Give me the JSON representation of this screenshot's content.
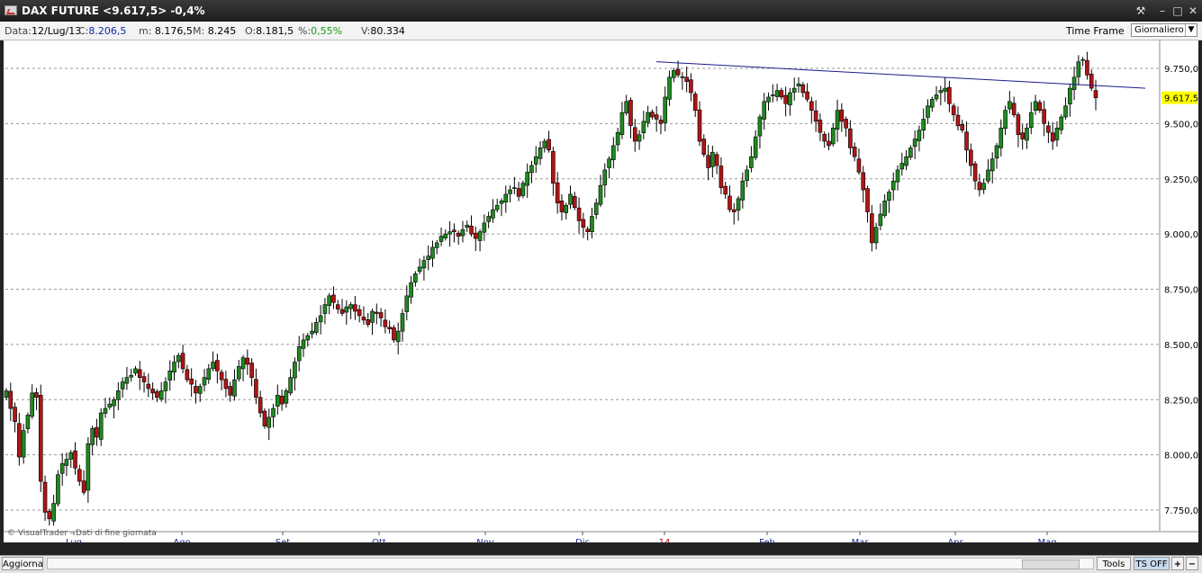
{
  "window": {
    "title": "DAX FUTURE <9.617,5> -0,4%"
  },
  "info": {
    "date_label": "Data:",
    "date_value": "12/Lug/13",
    "close_label": "C:",
    "close_value": "8.206,5",
    "low_label": "m:",
    "low_value": "8.176,5",
    "high_label": "M:",
    "high_value": "8.245",
    "open_label": "O:",
    "open_value": "8.181,5",
    "pct_label": "%:",
    "pct_value": "0,55%",
    "vol_label": "V:",
    "vol_value": "80.334",
    "timeframe_label": "Time Frame",
    "timeframe_value": "Giornaliero"
  },
  "bottom": {
    "update_label": "Aggiorna",
    "tools_label": "Tools",
    "ts_label": "TS OFF",
    "plus": "+",
    "minus": "−"
  },
  "watermark": "© VisualTrader - Dati di fine giornata",
  "colors": {
    "up": "#1f8a1f",
    "down": "#b01515",
    "trendline": "#1a1a8a",
    "last_price_bg": "#ffff00"
  },
  "chart_data": {
    "type": "candlestick",
    "y_ticks": [
      "9.750,0",
      "9.500,0",
      "9.250,0",
      "9.000,0",
      "8.750,0",
      "8.500,0",
      "8.250,0",
      "8.000,0",
      "7.750,0"
    ],
    "x_labels": [
      "Lug",
      "Ago",
      "Set",
      "Ott",
      "Nov",
      "Dic",
      "14",
      "Feb",
      "Mar",
      "Apr",
      "Mag"
    ],
    "last_price_label": "9.617,5",
    "trendline": {
      "from_value": 9780,
      "to_value": 9660
    },
    "ylim": [
      7680,
      9840
    ],
    "closes": [
      8290,
      8210,
      8150,
      7990,
      8110,
      8180,
      8280,
      8260,
      7880,
      7740,
      7710,
      7780,
      7910,
      7960,
      7980,
      8010,
      7940,
      7880,
      7830,
      8050,
      8120,
      8080,
      8190,
      8210,
      8230,
      8250,
      8290,
      8330,
      8350,
      8360,
      8390,
      8350,
      8330,
      8300,
      8280,
      8260,
      8290,
      8330,
      8380,
      8420,
      8450,
      8390,
      8340,
      8320,
      8280,
      8310,
      8350,
      8390,
      8420,
      8380,
      8340,
      8300,
      8270,
      8340,
      8400,
      8440,
      8410,
      8350,
      8260,
      8190,
      8130,
      8170,
      8210,
      8270,
      8230,
      8290,
      8350,
      8420,
      8490,
      8520,
      8540,
      8560,
      8600,
      8630,
      8680,
      8720,
      8690,
      8660,
      8640,
      8670,
      8680,
      8650,
      8630,
      8610,
      8590,
      8650,
      8640,
      8620,
      8580,
      8570,
      8520,
      8560,
      8640,
      8720,
      8780,
      8820,
      8850,
      8880,
      8900,
      8940,
      8960,
      8990,
      9000,
      9010,
      9010,
      8990,
      9020,
      9040,
      9000,
      8980,
      9010,
      9050,
      9080,
      9110,
      9130,
      9150,
      9180,
      9200,
      9210,
      9170,
      9230,
      9280,
      9310,
      9350,
      9390,
      9420,
      9380,
      9230,
      9140,
      9100,
      9130,
      9180,
      9120,
      9060,
      9030,
      9010,
      9080,
      9140,
      9220,
      9290,
      9340,
      9400,
      9460,
      9550,
      9600,
      9490,
      9420,
      9450,
      9510,
      9550,
      9530,
      9520,
      9500,
      9620,
      9710,
      9740,
      9720,
      9710,
      9690,
      9640,
      9560,
      9420,
      9360,
      9300,
      9370,
      9310,
      9210,
      9180,
      9110,
      9100,
      9160,
      9240,
      9290,
      9350,
      9440,
      9530,
      9600,
      9620,
      9630,
      9650,
      9620,
      9590,
      9640,
      9660,
      9680,
      9640,
      9610,
      9560,
      9510,
      9460,
      9420,
      9400,
      9480,
      9560,
      9510,
      9480,
      9390,
      9350,
      9280,
      9200,
      9100,
      8960,
      9030,
      9090,
      9150,
      9190,
      9240,
      9290,
      9320,
      9350,
      9390,
      9430,
      9470,
      9520,
      9580,
      9610,
      9630,
      9650,
      9660,
      9590,
      9540,
      9490,
      9470,
      9380,
      9310,
      9240,
      9200,
      9230,
      9290,
      9340,
      9400,
      9480,
      9560,
      9600,
      9540,
      9450,
      9430,
      9480,
      9550,
      9600,
      9560,
      9500,
      9460,
      9420,
      9480,
      9530,
      9580,
      9660,
      9710,
      9780,
      9790,
      9720,
      9660,
      9617
    ]
  }
}
